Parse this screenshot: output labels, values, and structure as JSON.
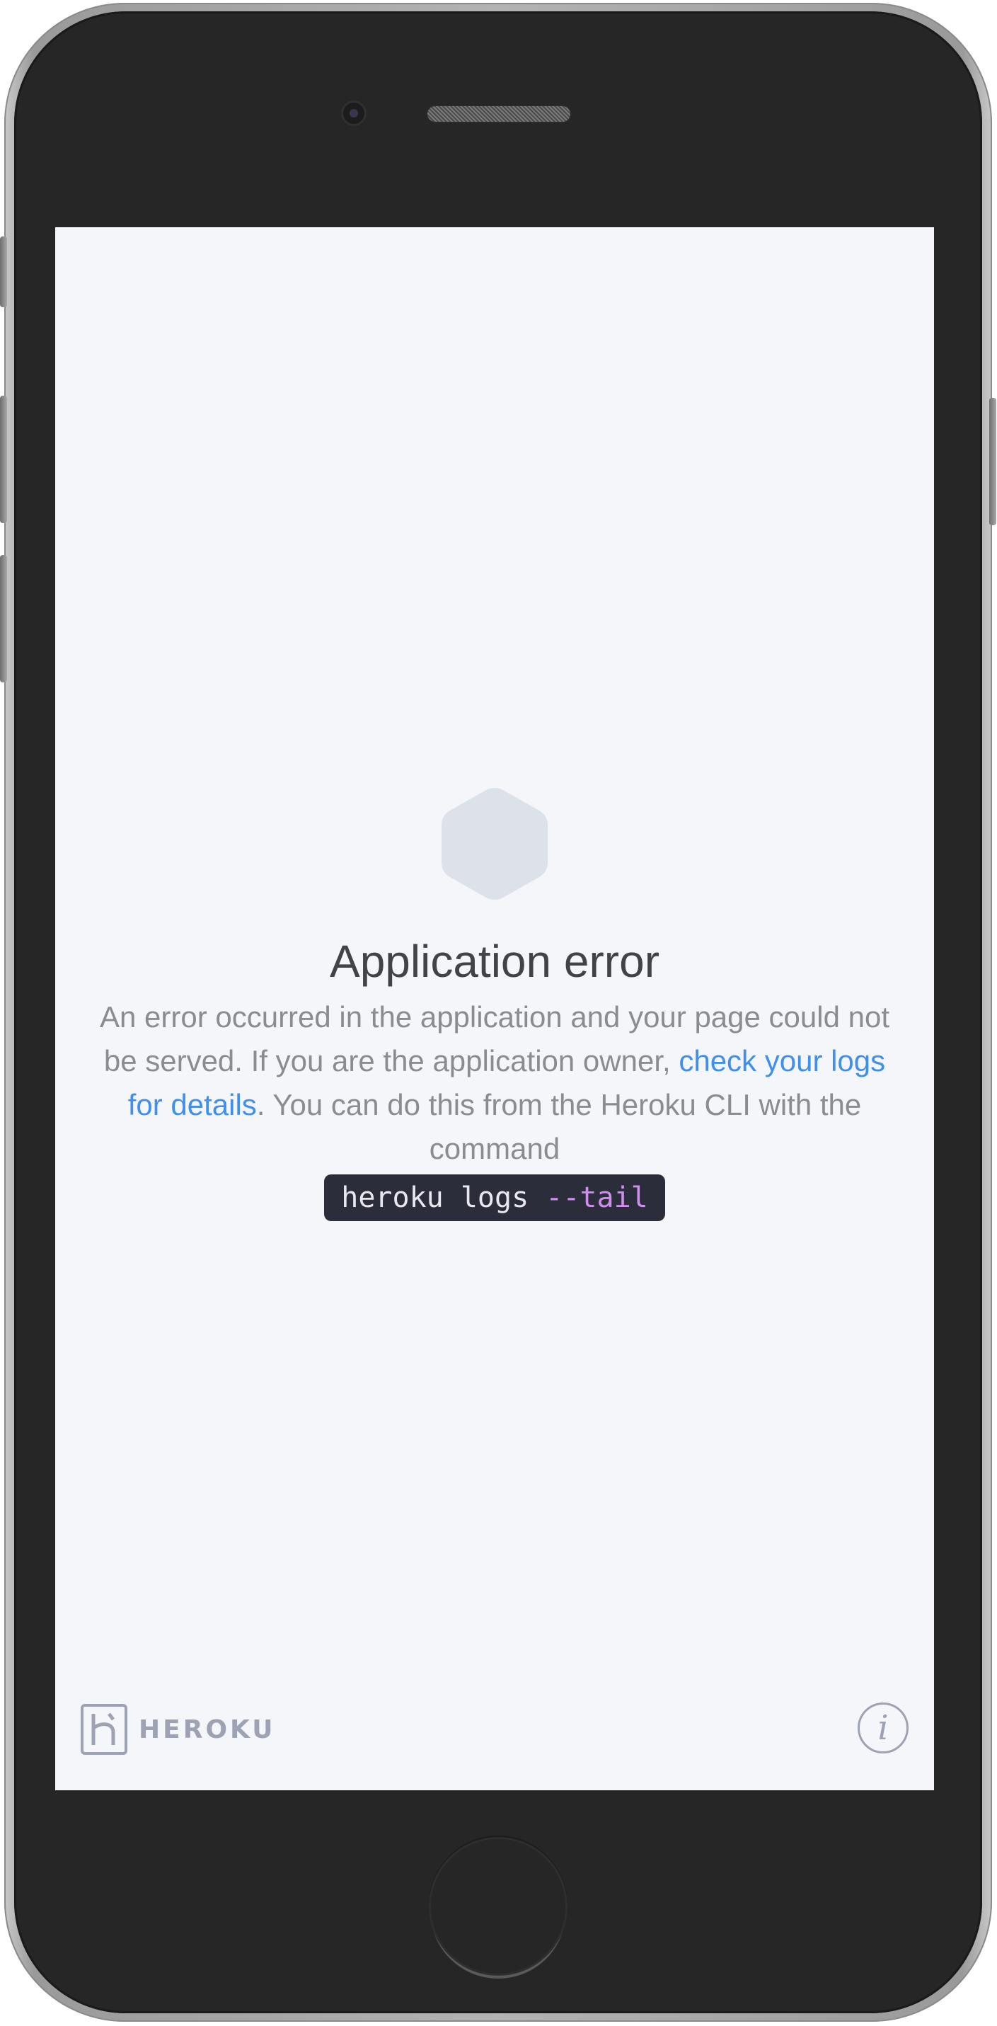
{
  "device": {
    "type": "smartphone"
  },
  "error_page": {
    "title": "Application error",
    "message": {
      "part1": "An error occurred in the application and your page could not be served. If you are the application owner, ",
      "link_text": "check your logs for details",
      "part2": ". You can do this from the Heroku CLI with the command"
    },
    "command": {
      "base": "heroku logs ",
      "flag": "--tail"
    }
  },
  "footer": {
    "brand": "HEROKU",
    "info_glyph": "i"
  },
  "colors": {
    "background": "#f5f6fa",
    "title": "#404347",
    "text": "#8a8c92",
    "link": "#408fec",
    "command_bg": "#2c2d3b",
    "command_flag": "#cf8ef0",
    "brand": "#9da3b4",
    "hexagon": "#dde1ea"
  },
  "icons": {
    "status": "hexagon-icon",
    "logo": "heroku-logo-icon",
    "info": "info-icon"
  }
}
